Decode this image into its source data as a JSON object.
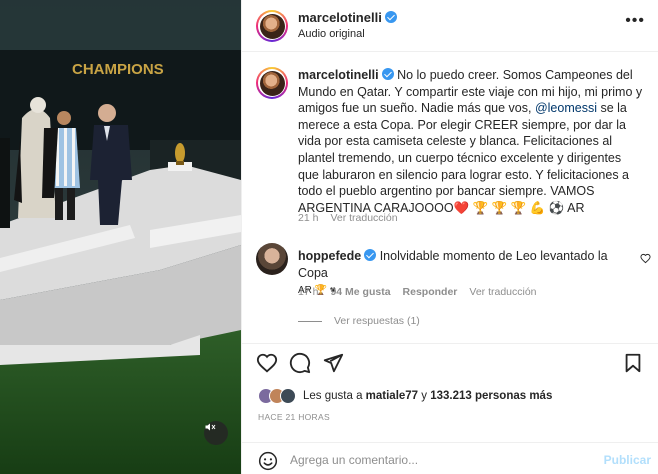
{
  "post": {
    "author": "marcelotinelli",
    "audio": "Audio original"
  },
  "caption": {
    "username": "marcelotinelli",
    "text_before_mention": "No lo puedo creer. Somos Campeones del Mundo en Qatar. Y compartir este viaje con mi hijo, mi primo y amigos fue un sueño. Nadie más que vos, ",
    "mention": "@leomessi",
    "text_after_mention": " se la merece a esta Copa. Por elegir CREER siempre, por dar la vida por esta camiseta celeste y blanca. Felicitaciones al plantel tremendo, un cuerpo técnico excelente y dirigentes que laburaron en silencio para lograr esto. Y felicitaciones a todo el pueblo argentino por bancar siempre. VAMOS ARGENTINA CARAJOOOO❤️ 🏆 🏆 🏆 💪 ⚽ AR",
    "time": "21 h",
    "translate": "Ver traducción"
  },
  "comment": {
    "username": "hoppefede",
    "text": "Inolvidable momento de Leo levantado la Copa",
    "text_line2": "AR 🏆 ♥",
    "time": "17 h",
    "likes": "94 Me gusta",
    "reply": "Responder",
    "translate": "Ver traducción",
    "view_replies": "Ver respuestas (1)"
  },
  "likes": {
    "prefix": "Les gusta a ",
    "user": "matiale77",
    "middle": " y ",
    "count": "133.213 personas más"
  },
  "time_ago": "HACE 21 HORAS",
  "composer": {
    "placeholder": "Agrega un comentario...",
    "post_label": "Publicar"
  },
  "media": {
    "banner_text": "CHAMPIONS"
  },
  "colors": {
    "verified": "#3897f0",
    "mention": "#00376b",
    "muted": "#8e8e8e",
    "publish_disabled": "#b2dffc",
    "pitch": "#1f4d1c"
  },
  "icons": [
    "heart-icon",
    "comment-icon",
    "share-icon",
    "bookmark-icon",
    "emoji-icon",
    "mute-icon",
    "more-icon",
    "verified-icon"
  ]
}
